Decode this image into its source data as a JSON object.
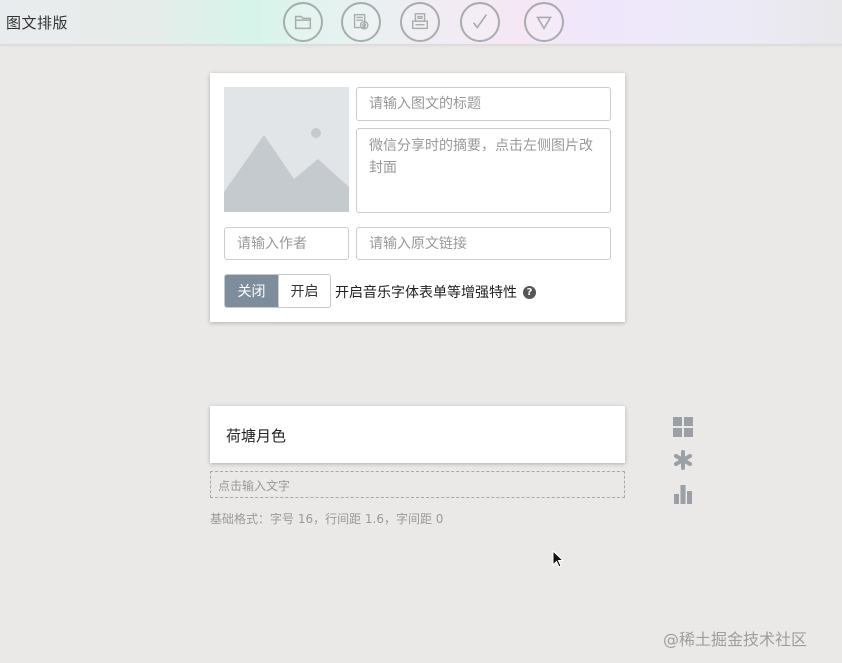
{
  "app": {
    "title": "图文排版"
  },
  "toolbar": {
    "buttons": [
      {
        "icon": "folder-icon"
      },
      {
        "icon": "preview-icon"
      },
      {
        "icon": "print-icon"
      },
      {
        "icon": "check-icon"
      },
      {
        "icon": "dropdown-triangle-icon"
      }
    ]
  },
  "article": {
    "title_placeholder": "请输入图文的标题",
    "summary_placeholder": "微信分享时的摘要，点击左侧图片改封面",
    "author_placeholder": "请输入作者",
    "link_placeholder": "请输入原文链接",
    "toggle": {
      "off_label": "关闭",
      "on_label": "开启",
      "selected": "关闭"
    },
    "feature_label": "开启音乐字体表单等增强特性",
    "help_icon": "question-circle-icon"
  },
  "content": {
    "paragraph_text": "荷塘月色",
    "input_placeholder": "点击输入文字",
    "base_format": "基础格式：字号 16，行间距 1.6，字间距 0"
  },
  "side_tools": [
    {
      "icon": "grid-icon"
    },
    {
      "icon": "asterisk-icon"
    },
    {
      "icon": "bar-chart-icon"
    }
  ],
  "watermark": "@稀土掘金技术社区",
  "colors": {
    "toggle_active": "#7d8d9c",
    "background": "#ebe9e7",
    "icon_gray": "#9aa0a5"
  }
}
